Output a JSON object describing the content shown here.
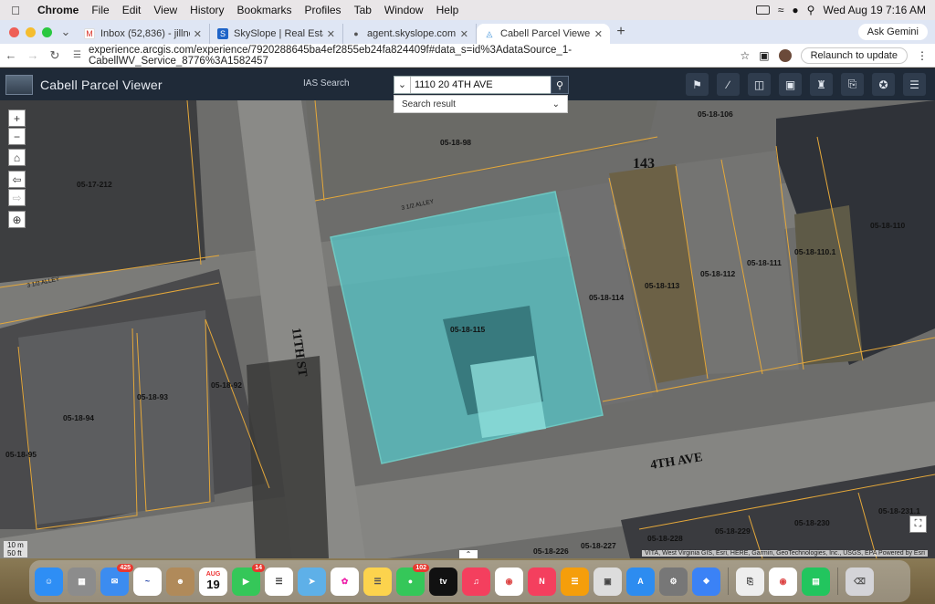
{
  "menubar": {
    "app": "Chrome",
    "items": [
      "File",
      "Edit",
      "View",
      "History",
      "Bookmarks",
      "Profiles",
      "Tab",
      "Window",
      "Help"
    ],
    "clock": "Wed Aug 19  7:16 AM"
  },
  "tabs": [
    {
      "title": "Inbox (52,836) - jillnelsonre",
      "icon": "gmail-icon"
    },
    {
      "title": "SkySlope | Real Estate Transa",
      "icon": "skyslope-icon"
    },
    {
      "title": "agent.skyslope.com",
      "icon": "globe-icon"
    },
    {
      "title": "Cabell Parcel Viewer",
      "icon": "arcgis-icon",
      "active": true
    }
  ],
  "ask_gemini": "Ask Gemini",
  "address": {
    "url": "experience.arcgis.com/experience/7920288645ba4ef2855eb24fa824409f#data_s=id%3AdataSource_1-CabellWV_Service_8776%3A1582457",
    "relaunch": "Relaunch to update"
  },
  "app": {
    "title": "Cabell Parcel Viewer",
    "ias_label": "IAS Search",
    "search_value": "1110 20 4TH AVE",
    "search_result_label": "Search result"
  },
  "map": {
    "parcels": [
      "05-18-106",
      "05-18-98",
      "05-17-212",
      "05-18-110",
      "05-18-110.1",
      "05-18-111",
      "05-18-112",
      "05-18-113",
      "05-18-114",
      "05-18-115",
      "05-18-93",
      "05-18-92",
      "05-18-94",
      "05-18-95",
      "05-18-228",
      "05-18-229",
      "05-18-230",
      "05-18-231.1",
      "05-18-226",
      "05-18-227"
    ],
    "block_number": "143",
    "streets": {
      "main": "4TH AVE",
      "cross": "11TH ST",
      "alley": "3 1/2 ALLEY"
    },
    "scale_m": "10 m",
    "scale_ft": "50 ft",
    "attribution": "VITA, West Virginia GIS, Esri, HERE, Garmin, GeoTechnologies, Inc., USGS, EPA   Powered by Esri"
  },
  "dock": {
    "badges": {
      "mail": "425",
      "facetime": "14",
      "messages": "102"
    },
    "calendar_month": "AUG",
    "calendar_day": "19"
  }
}
